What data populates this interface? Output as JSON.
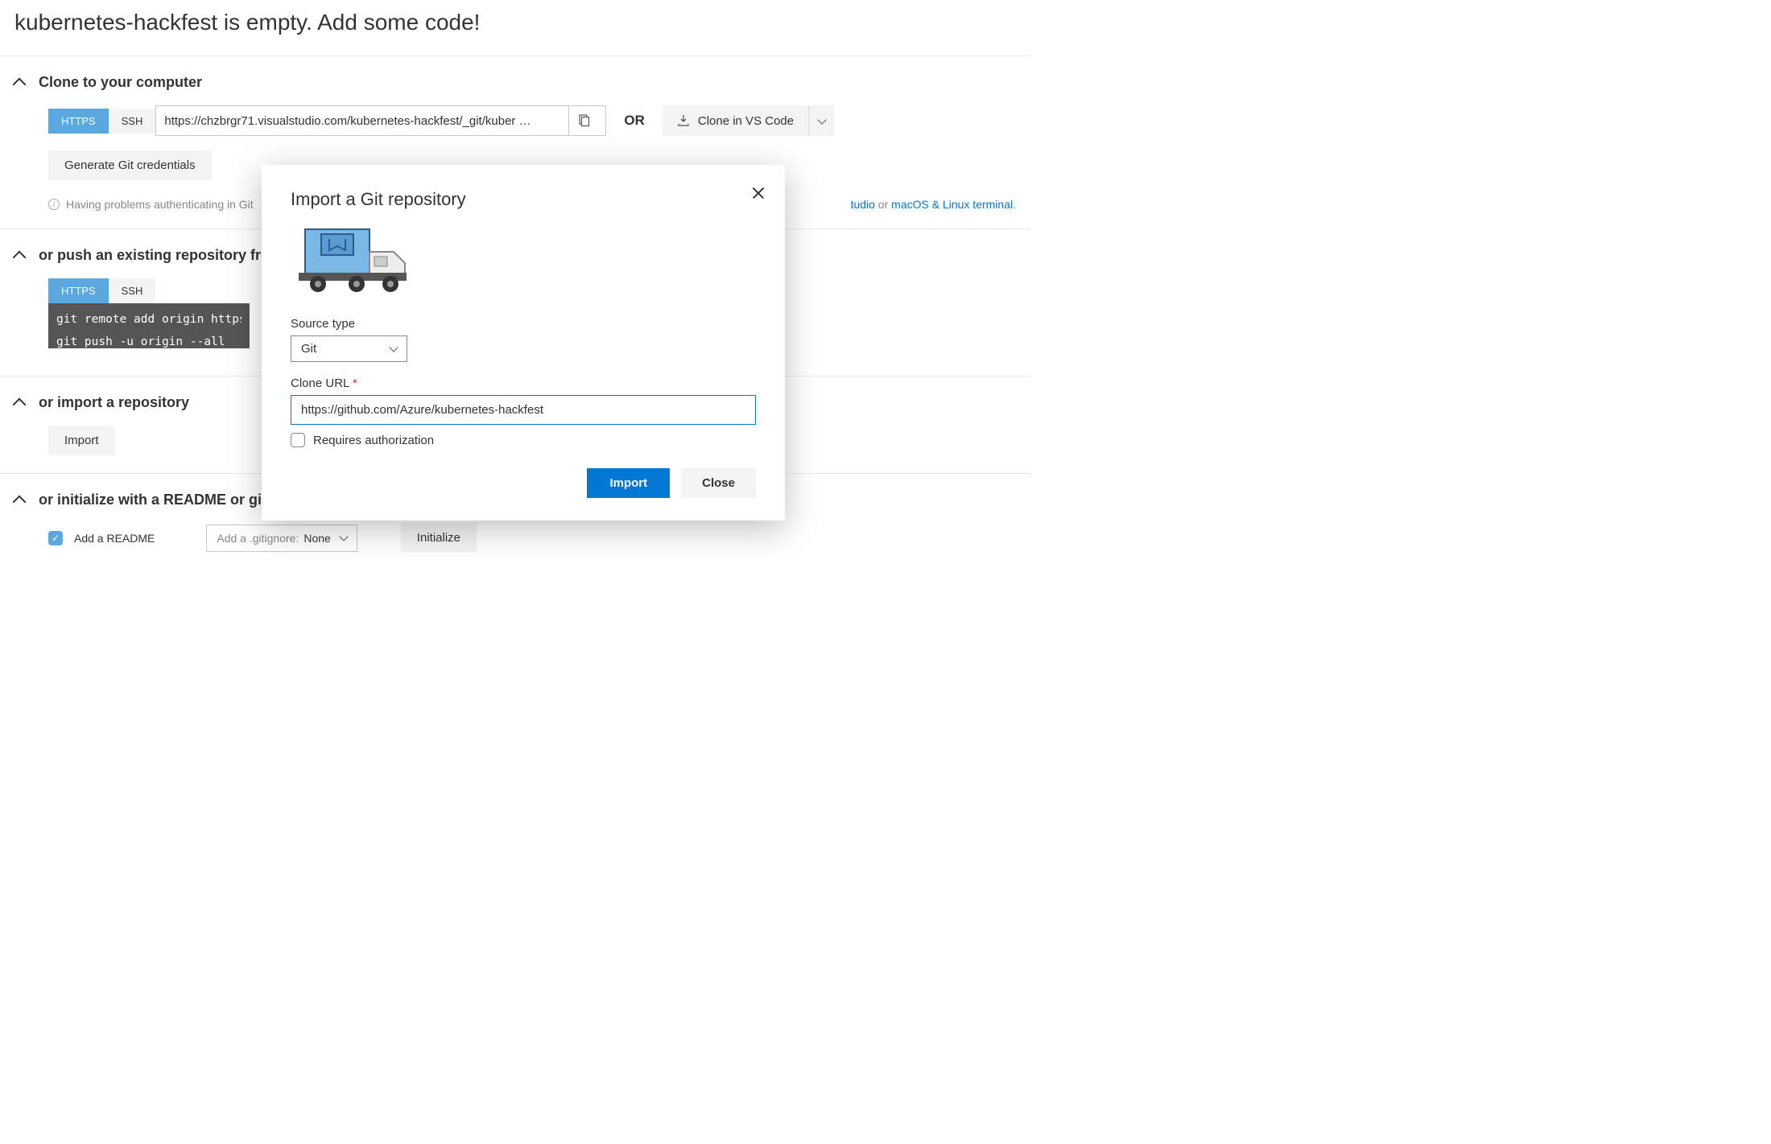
{
  "page_title": "kubernetes-hackfest is empty. Add some code!",
  "sections": {
    "clone": {
      "title": "Clone to your computer",
      "tabs": {
        "https": "HTTPS",
        "ssh": "SSH"
      },
      "url": "https://chzbrgr71.visualstudio.com/kubernetes-hackfest/_git/kuber …",
      "or": "OR",
      "vscode": "Clone in VS Code",
      "gen_creds": "Generate Git credentials",
      "help_prefix": "Having problems authenticating in Git",
      "help_mid": "tudio",
      "help_or": " or ",
      "help_link2": "macOS & Linux terminal",
      "help_period": "."
    },
    "push": {
      "title": "or push an existing repository from command line",
      "tabs": {
        "https": "HTTPS",
        "ssh": "SSH"
      },
      "code_line1": "git remote add origin https://chzbr",
      "code_line2": "git push -u origin --all"
    },
    "import": {
      "title": "or import a repository",
      "button": "Import"
    },
    "init": {
      "title": "or initialize with a README or gitignore",
      "readme_label": "Add a README",
      "gitignore_prefix": "Add a .gitignore: ",
      "gitignore_value": "None",
      "initialize": "Initialize"
    }
  },
  "modal": {
    "title": "Import a Git repository",
    "source_type_label": "Source type",
    "source_type_value": "Git",
    "clone_url_label": "Clone URL",
    "clone_url_value": "https://github.com/Azure/kubernetes-hackfest",
    "auth_label": "Requires authorization",
    "import_btn": "Import",
    "close_btn": "Close"
  }
}
